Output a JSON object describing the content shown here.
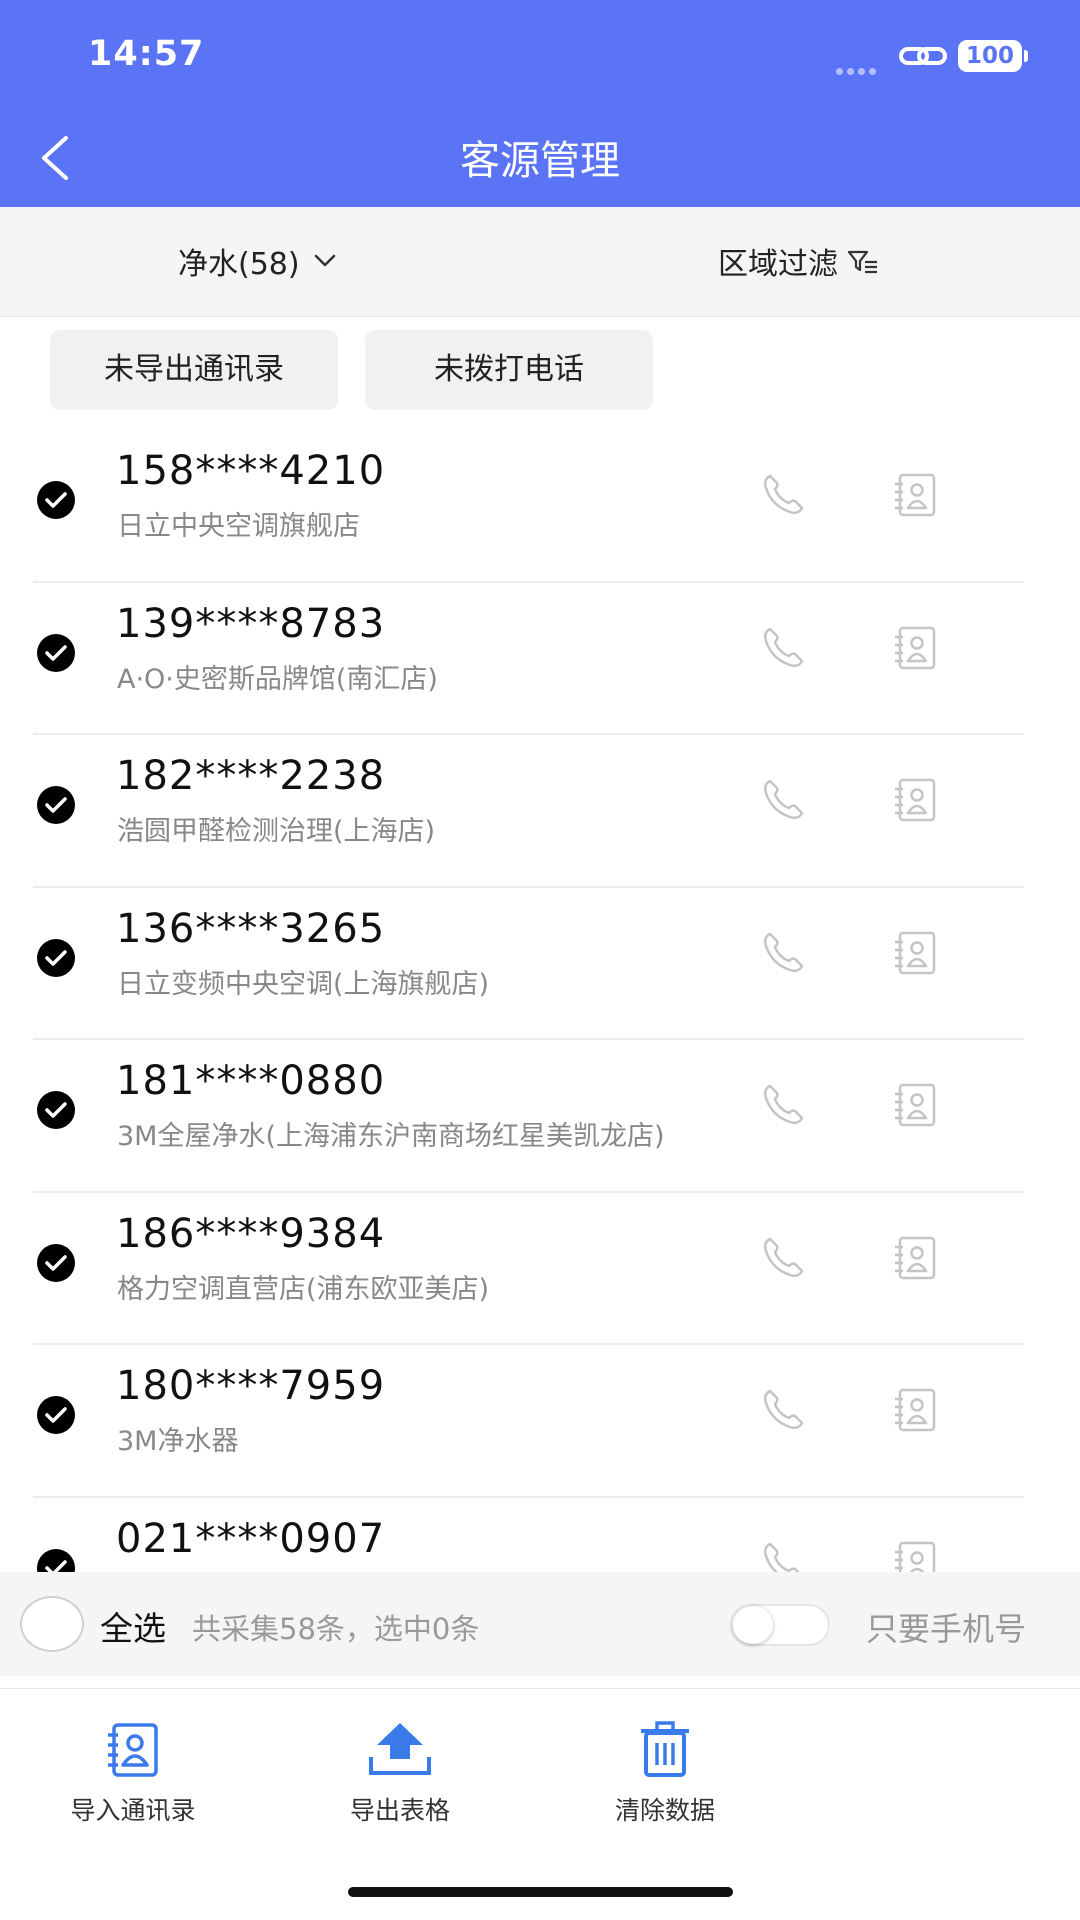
{
  "status_bar": {
    "time": "14:57",
    "battery": "100"
  },
  "header": {
    "title": "客源管理"
  },
  "filter_bar": {
    "category": "净水(58)",
    "region": "区域过滤"
  },
  "chips": [
    "未导出通讯录",
    "未拨打电话"
  ],
  "list": {
    "items": [
      {
        "phone": "158****4210",
        "store": "日立中央空调旗舰店"
      },
      {
        "phone": "139****8783",
        "store": "A·O·史密斯品牌馆(南汇店)"
      },
      {
        "phone": "182****2238",
        "store": "浩圆甲醛检测治理(上海店)"
      },
      {
        "phone": "136****3265",
        "store": "日立变频中央空调(上海旗舰店)"
      },
      {
        "phone": "181****0880",
        "store": "3M全屋净水(上海浦东沪南商场红星美凯龙店)"
      },
      {
        "phone": "186****9384",
        "store": "格力空调直营店(浦东欧亚美店)"
      },
      {
        "phone": "180****7959",
        "store": "3M净水器"
      },
      {
        "phone": "021****0907",
        "store": ""
      }
    ]
  },
  "select_bar": {
    "select_all": "全选",
    "summary": "共采集58条，选中0条",
    "mobile_only": "只要手机号",
    "mobile_only_enabled": false
  },
  "bottom_tabs": [
    {
      "label": "导入通讯录",
      "icon": "contact-book-icon",
      "color": "#3a7bea"
    },
    {
      "label": "导出表格",
      "icon": "upload-icon",
      "color": "#3a7bea"
    },
    {
      "label": "清除数据",
      "icon": "trash-icon",
      "color": "#3a7bea"
    }
  ],
  "colors": {
    "header": "#5b74f6",
    "accent": "#3a7bea"
  }
}
